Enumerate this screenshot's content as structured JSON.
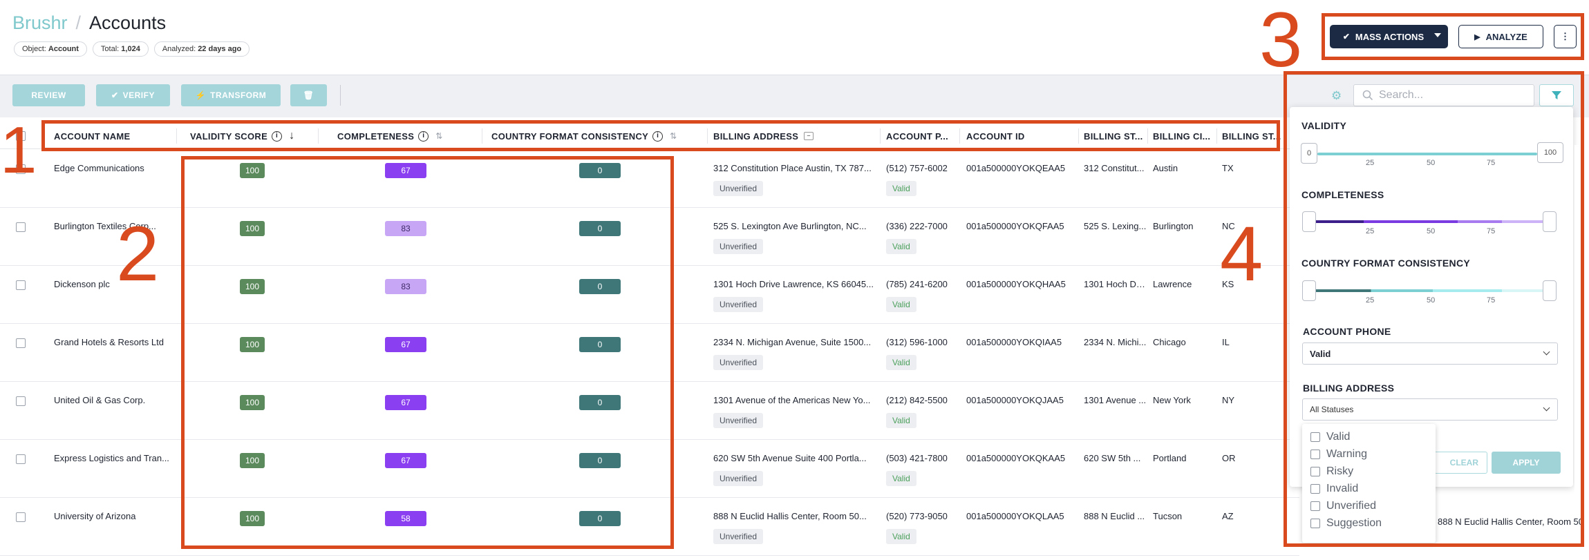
{
  "header": {
    "app_name": "Brushr",
    "separator": "/",
    "page_title": "Accounts",
    "chips": [
      {
        "label": "Object:",
        "value": "Account"
      },
      {
        "label": "Total:",
        "value": "1,024"
      },
      {
        "label": "Analyzed:",
        "value": "22 days ago"
      }
    ]
  },
  "top_actions": {
    "mass_actions": "MASS ACTIONS",
    "analyze": "ANALYZE",
    "more": "⋮"
  },
  "toolbar": {
    "review": "REVIEW",
    "verify": "VERIFY",
    "transform": "TRANSFORM",
    "search_placeholder": "Search..."
  },
  "columns": [
    "ACCOUNT NAME",
    "VALIDITY SCORE",
    "COMPLETENESS",
    "COUNTRY FORMAT CONSISTENCY",
    "BILLING ADDRESS",
    "ACCOUNT P...",
    "ACCOUNT ID",
    "BILLING ST...",
    "BILLING CI...",
    "BILLING ST..."
  ],
  "rows": [
    {
      "name": "Edge Communications",
      "validity": "100",
      "completeness": "67",
      "consistency": "0",
      "address": "312 Constitution Place Austin, TX 787...",
      "address_status": "Unverified",
      "phone": "(512) 757-6002",
      "phone_status": "Valid",
      "id": "001a500000YOKQEAA5",
      "street": "312 Constitut...",
      "city": "Austin",
      "state": "TX"
    },
    {
      "name": "Burlington Textiles Corp...",
      "validity": "100",
      "completeness": "83",
      "consistency": "0",
      "address": "525 S. Lexington Ave Burlington, NC...",
      "address_status": "Unverified",
      "phone": "(336) 222-7000",
      "phone_status": "Valid",
      "id": "001a500000YOKQFAA5",
      "street": "525 S. Lexing...",
      "city": "Burlington",
      "state": "NC"
    },
    {
      "name": "Dickenson plc",
      "validity": "100",
      "completeness": "83",
      "consistency": "0",
      "address": "1301 Hoch Drive Lawrence, KS 66045...",
      "address_status": "Unverified",
      "phone": "(785) 241-6200",
      "phone_status": "Valid",
      "id": "001a500000YOKQHAA5",
      "street": "1301 Hoch Dri...",
      "city": "Lawrence",
      "state": "KS"
    },
    {
      "name": "Grand Hotels & Resorts Ltd",
      "validity": "100",
      "completeness": "67",
      "consistency": "0",
      "address": "2334 N. Michigan Avenue, Suite 1500...",
      "address_status": "Unverified",
      "phone": "(312) 596-1000",
      "phone_status": "Valid",
      "id": "001a500000YOKQIAA5",
      "street": "2334 N. Michi...",
      "city": "Chicago",
      "state": "IL"
    },
    {
      "name": "United Oil & Gas Corp.",
      "validity": "100",
      "completeness": "67",
      "consistency": "0",
      "address": "1301 Avenue of the Americas New Yo...",
      "address_status": "Unverified",
      "phone": "(212) 842-5500",
      "phone_status": "Valid",
      "id": "001a500000YOKQJAA5",
      "street": "1301 Avenue ...",
      "city": "New York",
      "state": "NY"
    },
    {
      "name": "Express Logistics and Tran...",
      "validity": "100",
      "completeness": "67",
      "consistency": "0",
      "address": "620 SW 5th Avenue Suite 400 Portla...",
      "address_status": "Unverified",
      "phone": "(503) 421-7800",
      "phone_status": "Valid",
      "id": "001a500000YOKQKAA5",
      "street": "620 SW 5th ...",
      "city": "Portland",
      "state": "OR"
    },
    {
      "name": "University of Arizona",
      "validity": "100",
      "completeness": "58",
      "consistency": "0",
      "address": "888 N Euclid Hallis Center, Room 50...",
      "address_status": "Unverified",
      "phone": "(520) 773-9050",
      "phone_status": "Valid",
      "id": "001a500000YOKQLAA5",
      "street": "888 N Euclid ...",
      "city": "Tucson",
      "state": "AZ"
    }
  ],
  "filter_panel": {
    "validity_label": "VALIDITY",
    "validity_min": "0",
    "validity_max": "100",
    "ticks": [
      "25",
      "50",
      "75"
    ],
    "completeness_label": "COMPLETENESS",
    "consistency_label": "COUNTRY FORMAT CONSISTENCY",
    "phone_label": "ACCOUNT PHONE",
    "phone_value": "Valid",
    "billing_label": "BILLING ADDRESS",
    "billing_value": "All Statuses",
    "clear": "CLEAR",
    "apply": "APPLY",
    "status_options": [
      "Valid",
      "Warning",
      "Risky",
      "Invalid",
      "Unverified",
      "Suggestion"
    ],
    "overflow_text": "888 N Euclid Hallis Center, Room 50"
  },
  "annotations": [
    "1",
    "2",
    "3",
    "4"
  ],
  "colors": {
    "validity_badge": "#5b8a5c",
    "completeness_dark": "#8a3ff0",
    "completeness_light": "#c8a6f6",
    "consistency_badge": "#3f7779",
    "annotation": "#d94a1e",
    "navy": "#1c2a44",
    "teal": "#7fc8cc"
  }
}
